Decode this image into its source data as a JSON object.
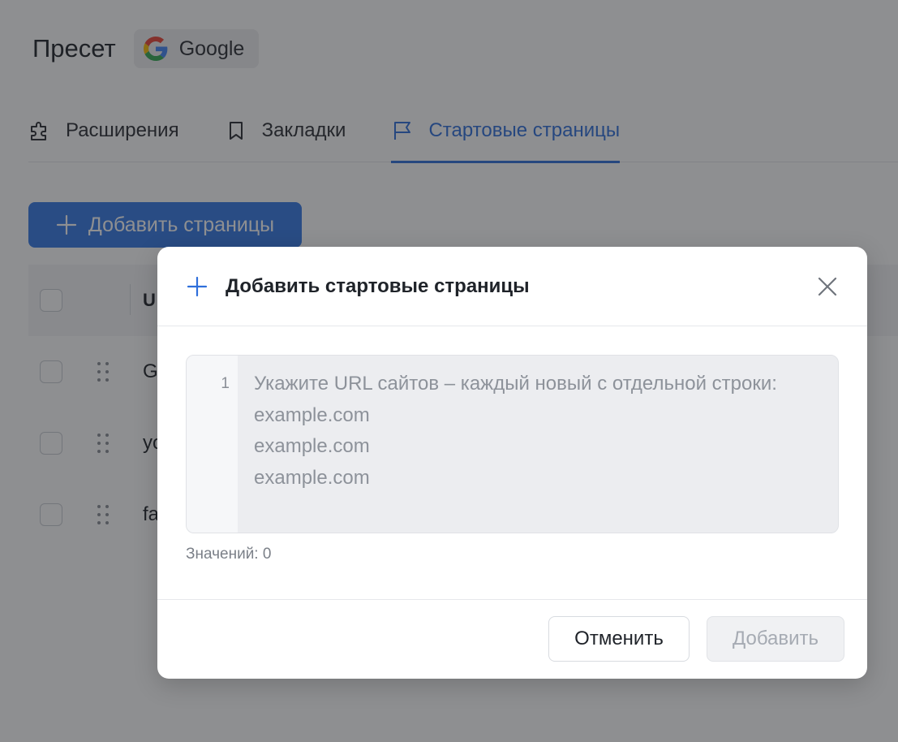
{
  "preset": {
    "title": "Пресет",
    "chip_label": "Google",
    "chip_icon": "google-logo-icon"
  },
  "tabs": [
    {
      "label": "Расширения",
      "icon": "puzzle-icon",
      "active": false
    },
    {
      "label": "Закладки",
      "icon": "bookmark-icon",
      "active": false
    },
    {
      "label": "Стартовые страницы",
      "icon": "flag-icon",
      "active": true
    }
  ],
  "toolbar": {
    "add_pages_label": "Добавить страницы"
  },
  "table": {
    "header_url": "U",
    "rows": [
      {
        "url": "G"
      },
      {
        "url": "yo"
      },
      {
        "url": "fa"
      }
    ]
  },
  "modal": {
    "title": "Добавить стартовые страницы",
    "editor": {
      "line_number": "1",
      "value": "",
      "placeholder": "Укажите URL сайтов – каждый новый с отдельной строки:\nexample.com\nexample.com\nexample.com"
    },
    "count_label": "Значений: 0",
    "cancel_label": "Отменить",
    "add_label": "Добавить"
  },
  "colors": {
    "accent": "#2f6fdb",
    "primary_button": "#3578e5",
    "overlay": "rgba(30,32,36,0.5)"
  }
}
